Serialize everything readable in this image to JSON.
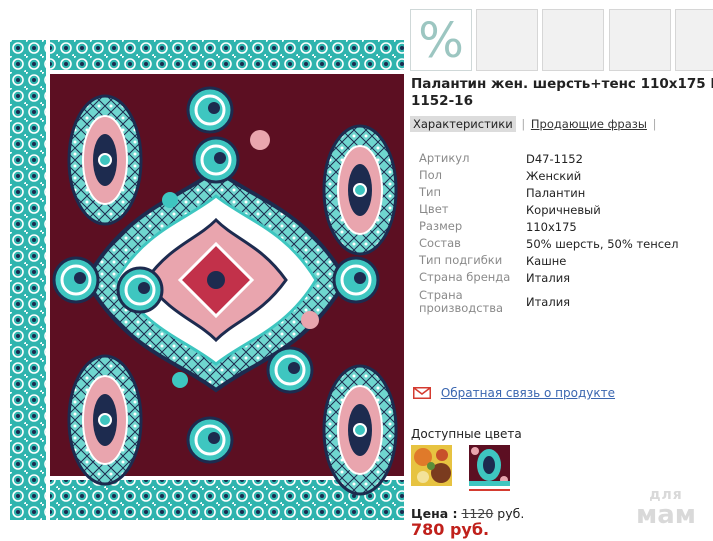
{
  "thumbnails": {
    "discount_symbol": "%",
    "colors": {
      "discount_bg": "#ffffff",
      "discount_glyph": "#9cc6c1",
      "empty_bg": "#f1f1f1"
    }
  },
  "product": {
    "title_line1": "Палантин жен. шерсть+тенс 110x175 D47-",
    "title_line2": "1152-16"
  },
  "tabs": {
    "characteristics": "Характеристики",
    "selling_phrases": "Продающие фразы",
    "separator": "|"
  },
  "specs": [
    {
      "label": "Артикул",
      "value": "D47-1152"
    },
    {
      "label": "Пол",
      "value": "Женский"
    },
    {
      "label": "Тип",
      "value": "Палантин"
    },
    {
      "label": "Цвет",
      "value": "Коричневый"
    },
    {
      "label": "Размер",
      "value": "110x175"
    },
    {
      "label": "Состав",
      "value": "50% шерсть, 50% тенсел"
    },
    {
      "label": "Тип подгибки",
      "value": "Кашне"
    },
    {
      "label": "Страна бренда",
      "value": "Италия"
    },
    {
      "label": "Страна производства",
      "value": "Италия"
    }
  ],
  "feedback": {
    "link": "Обратная связь о продукте"
  },
  "colors_section": {
    "label": "Доступные цвета",
    "selected_index": 2
  },
  "price": {
    "label": "Цена :",
    "old_value": "1120",
    "old_currency": "руб.",
    "new": "780 руб."
  },
  "watermark": {
    "line1": "для",
    "line2": "мам"
  },
  "palette": {
    "fabric_bg": "#5c0f22",
    "turquoise": "#3ec6c0",
    "navy": "#1d2b4f",
    "pink": "#e9a5ae",
    "price_red": "#c0201b",
    "link_blue": "#3a66b0"
  }
}
